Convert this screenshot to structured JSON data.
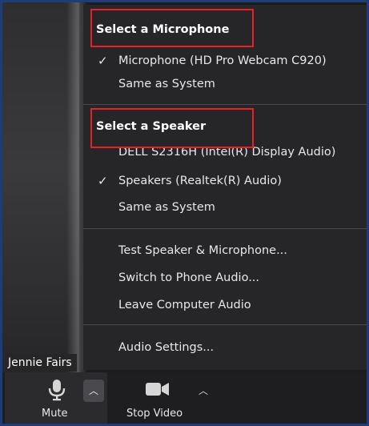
{
  "participant": {
    "name": "Jennie Fairs"
  },
  "menu": {
    "microphone_section": {
      "title": "Select a Microphone",
      "items": [
        {
          "label": "Microphone (HD Pro Webcam C920)",
          "checked": true
        },
        {
          "label": "Same as System",
          "checked": false
        }
      ]
    },
    "speaker_section": {
      "title": "Select a Speaker",
      "items": [
        {
          "label": "DELL S2316H (Intel(R) Display Audio)",
          "checked": false
        },
        {
          "label": "Speakers (Realtek(R) Audio)",
          "checked": true
        },
        {
          "label": "Same as System",
          "checked": false
        }
      ]
    },
    "actions": [
      {
        "label": "Test Speaker & Microphone..."
      },
      {
        "label": "Switch to Phone Audio..."
      },
      {
        "label": "Leave Computer Audio"
      }
    ],
    "settings": {
      "label": "Audio Settings..."
    }
  },
  "toolbar": {
    "mute_label": "Mute",
    "stop_video_label": "Stop Video"
  },
  "icons": {
    "check": "check-icon",
    "microphone": "microphone-icon",
    "video_camera": "video-camera-icon",
    "caret": "caret-up-icon"
  },
  "colors": {
    "highlight": "#e8202a",
    "menu_bg": "#262628",
    "frame_border": "#1f3b78"
  }
}
